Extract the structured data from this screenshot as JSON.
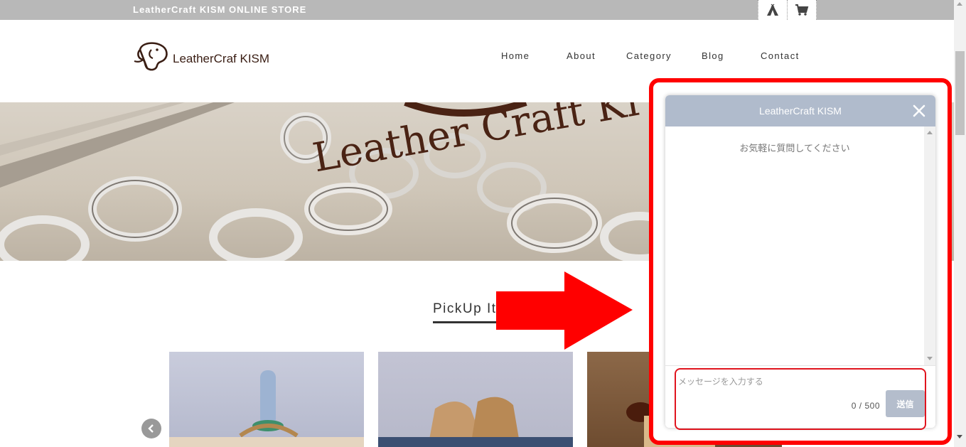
{
  "topbar": {
    "store_name": "LeatherCraft KISM ONLINE STORE",
    "icons": [
      "teepee-icon",
      "cart-icon"
    ]
  },
  "header": {
    "logo_text": "LeatherCraf KISM",
    "nav": [
      "Home",
      "About",
      "Category",
      "Blog",
      "Contact"
    ]
  },
  "hero": {
    "watermark_text": "Leather Craft Ki"
  },
  "pickup": {
    "title": "PickUp Item"
  },
  "chat": {
    "title": "LeatherCraft KISM",
    "welcome": "お気軽に質問してください",
    "input_placeholder": "メッセージを入力する",
    "input_value": "",
    "counter": "0 / 500",
    "send_label": "送信"
  },
  "colors": {
    "annotation_red": "#ff0000",
    "chat_header": "#b0bbcc",
    "send_button": "#b4bdcc",
    "topbar": "#b8b8b8"
  }
}
